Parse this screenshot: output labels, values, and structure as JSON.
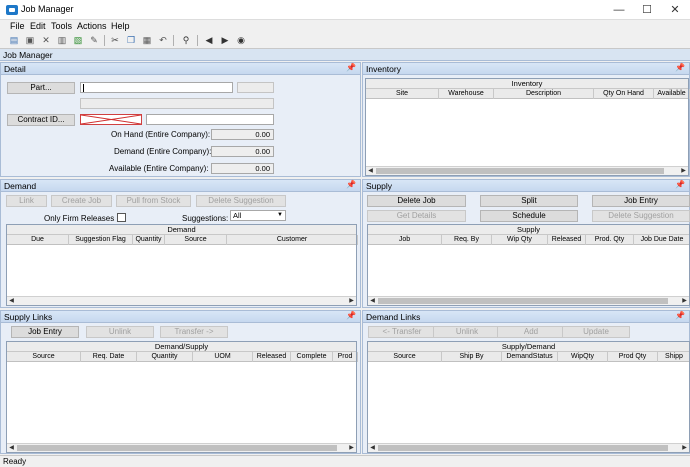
{
  "window": {
    "title": "Job Manager",
    "min": "—",
    "max": "☐",
    "close": "✕"
  },
  "menu": [
    {
      "label": "File"
    },
    {
      "label": "Edit"
    },
    {
      "label": "Tools"
    },
    {
      "label": "Actions"
    },
    {
      "label": "Help"
    }
  ],
  "main_header": "Job Manager",
  "detail": {
    "title": "Detail",
    "part_button": "Part...",
    "contract_button": "Contract ID...",
    "on_hand_label": "On Hand (Entire Company):",
    "on_hand_value": "0.00",
    "demand_label": "Demand (Entire Company):",
    "demand_value": "0.00",
    "available_label": "Available (Entire Company):",
    "available_value": "0.00"
  },
  "inventory": {
    "title": "Inventory",
    "grid_title": "Inventory",
    "columns": [
      "Site",
      "Warehouse",
      "Description",
      "Qty On Hand",
      "Available"
    ]
  },
  "demand": {
    "title": "Demand",
    "buttons": [
      "Link",
      "Create Job",
      "Pull from Stock",
      "Delete Suggestion"
    ],
    "firm_label": "Only Firm Releases",
    "suggestions_label": "Suggestions:",
    "suggestions_value": "All",
    "grid_title": "Demand",
    "columns": [
      "Due",
      "Suggestion Flag",
      "Quantity",
      "Source",
      "Customer"
    ]
  },
  "supply": {
    "title": "Supply",
    "buttons_row1": [
      "Delete Job",
      "Split",
      "Job Entry"
    ],
    "buttons_row2": [
      "Get Details",
      "Schedule",
      "Delete Suggestion"
    ],
    "grid_title": "Supply",
    "columns": [
      "Job",
      "Req. By",
      "Wip Qty",
      "Released",
      "Prod. Qty",
      "Job Due Date"
    ]
  },
  "supply_links": {
    "title": "Supply Links",
    "buttons": [
      "Job Entry",
      "Unlink",
      "Transfer ->"
    ],
    "grid_title": "Demand/Supply",
    "columns": [
      "Source",
      "Req. Date",
      "Quantity",
      "UOM",
      "Released",
      "Complete",
      "Prod"
    ]
  },
  "demand_links": {
    "title": "Demand Links",
    "buttons": [
      "<- Transfer",
      "Unlink",
      "Add",
      "Update"
    ],
    "grid_title": "Supply/Demand",
    "columns": [
      "Source",
      "Ship By",
      "DemandStatus",
      "WipQty",
      "Prod Qty",
      "Shipp"
    ]
  },
  "status": "Ready"
}
